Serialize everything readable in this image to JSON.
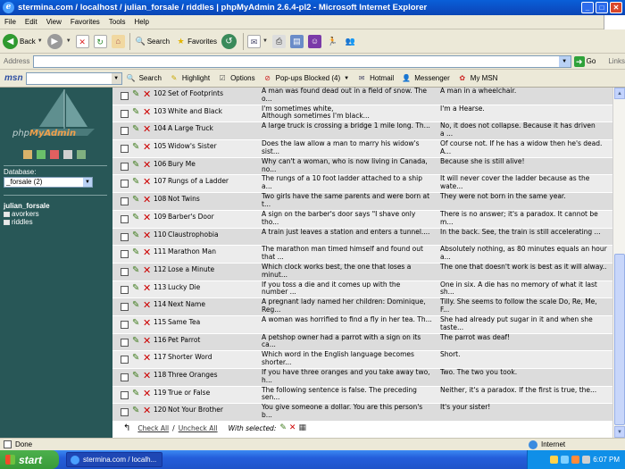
{
  "window": {
    "title": "stermina.com / localhost / julian_forsale / riddles | phpMyAdmin 2.6.4-pl2 - Microsoft Internet Explorer",
    "min": "_",
    "max": "□",
    "close": "✕"
  },
  "menu": [
    "File",
    "Edit",
    "View",
    "Favorites",
    "Tools",
    "Help"
  ],
  "toolbar": {
    "back": "Back",
    "search": "Search",
    "favorites": "Favorites"
  },
  "address": {
    "label": "Address",
    "value": "",
    "go": "Go",
    "links": "Links"
  },
  "msn": {
    "logo": "msn",
    "search": "Search",
    "highlight": "Highlight",
    "options": "Options",
    "popups": "Pop-ups Blocked (4)",
    "hotmail": "Hotmail",
    "messenger": "Messenger",
    "mymsn": "My MSN"
  },
  "sidebar": {
    "logo_text_1": "php",
    "logo_text_2": "MyAdmin",
    "database_label": "Database:",
    "database_value": "_forsale (2)",
    "db_name": "julian_forsale",
    "tables": [
      "avorkers",
      "riddles"
    ]
  },
  "rows": [
    {
      "id": "102",
      "name": "Set of Footprints",
      "q": "A man was found dead out in a field of snow. The\no...",
      "a": "A man in a wheelchair."
    },
    {
      "id": "103",
      "name": "White and Black",
      "q": "I'm sometimes white,\nAlthough sometimes I'm black...",
      "a": "I'm a Hearse."
    },
    {
      "id": "104",
      "name": "A Large Truck",
      "q": "A large truck is crossing a bridge 1 mile long. Th...",
      "a": "No, it does not collapse. Because it has driven\na ..."
    },
    {
      "id": "105",
      "name": "Widow's Sister",
      "q": "Does the law allow a man to marry his widow's\nsist...",
      "a": "Of course not. If he has a widow then he's dead.\nA..."
    },
    {
      "id": "106",
      "name": "Bury Me",
      "q": "Why can't a woman, who is now living in Canada,\nno...",
      "a": "Because she is still alive!"
    },
    {
      "id": "107",
      "name": "Rungs of a Ladder",
      "q": "The rungs of a 10 foot ladder attached to a ship\na...",
      "a": "It will never cover the ladder because as the\nwate..."
    },
    {
      "id": "108",
      "name": "Not Twins",
      "q": "Two girls have the same parents and were born at\nt...",
      "a": "They were not born in the same year."
    },
    {
      "id": "109",
      "name": "Barber's Door",
      "q": "A sign on the barber's door says \"I shave only\ntho...",
      "a": "There is no answer; it's a paradox. It cannot be\nm..."
    },
    {
      "id": "110",
      "name": "Claustrophobia",
      "q": "A train just leaves a station and enters a tunnel....",
      "a": "In the back. See, the train is still accelerating ..."
    },
    {
      "id": "111",
      "name": "Marathon Man",
      "q": "The marathon man timed himself and found out\nthat ...",
      "a": "Absolutely nothing, as 80 minutes equals an hour\na..."
    },
    {
      "id": "112",
      "name": "Lose a Minute",
      "q": "Which clock works best, the one that loses a\nminut...",
      "a": "The one that doesn't work is best as it will alway..."
    },
    {
      "id": "113",
      "name": "Lucky Die",
      "q": "If you toss a die and it comes up with the\nnumber ...",
      "a": "One in six. A die has no memory of what it last\nsh..."
    },
    {
      "id": "114",
      "name": "Next Name",
      "q": "A pregnant lady named her children: Dominique,\nReg...",
      "a": "Tilly. She seems to follow the scale Do, Re, Me,\nF..."
    },
    {
      "id": "115",
      "name": "Same Tea",
      "q": "A woman was horrified to find a fly in her tea. Th...",
      "a": "She had already put sugar in it and when she\ntaste..."
    },
    {
      "id": "116",
      "name": "Pet Parrot",
      "q": "A petshop owner had a parrot with a sign on its\nca...",
      "a": "The parrot was deaf!"
    },
    {
      "id": "117",
      "name": "Shorter Word",
      "q": "Which word in the English language becomes\nshorter...",
      "a": "Short."
    },
    {
      "id": "118",
      "name": "Three Oranges",
      "q": "If you have three oranges and you take away two,\nh...",
      "a": "Two. The two you took."
    },
    {
      "id": "119",
      "name": "True or False",
      "q": "The following sentence is false. The preceding\nsen...",
      "a": "Neither, it's a paradox. If the first is true, the..."
    },
    {
      "id": "120",
      "name": "Not Your Brother",
      "q": "You give someone a dollar. You are this person's\nb...",
      "a": "It's your sister!"
    }
  ],
  "footer": {
    "check_all": "Check All",
    "slash": "/",
    "uncheck_all": "Uncheck All",
    "with_selected": "With selected:"
  },
  "status": {
    "done": "Done",
    "zone": "Internet"
  },
  "taskbar": {
    "start": "start",
    "task": "stermina.com / localh...",
    "clock": "6:07 PM"
  }
}
